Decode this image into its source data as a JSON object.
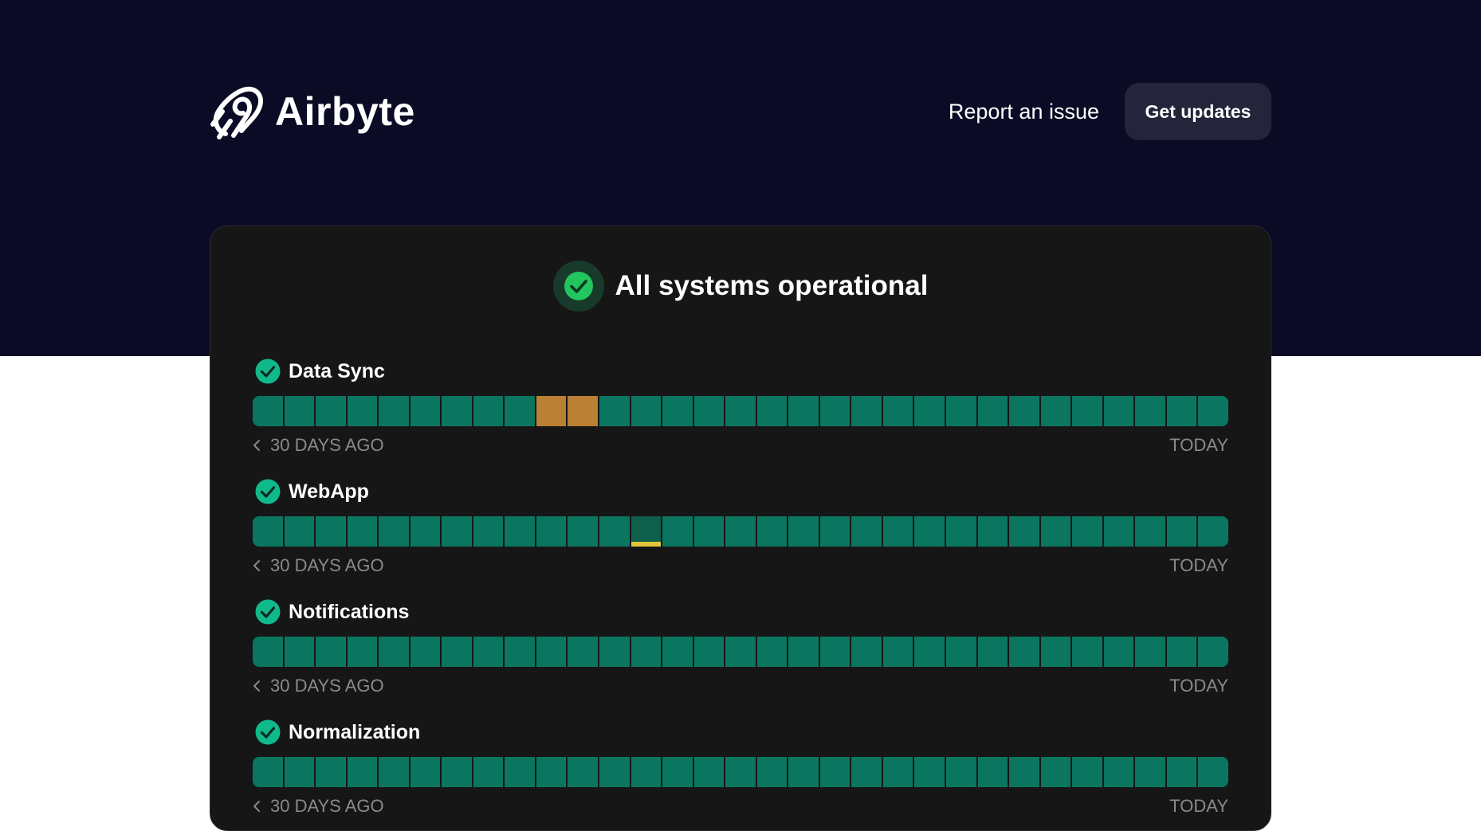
{
  "brand": {
    "name": "Airbyte",
    "logo_icon": "airbyte-logo-icon"
  },
  "nav": {
    "report_label": "Report an issue",
    "updates_label": "Get updates"
  },
  "colors": {
    "hero_bg": "#0b0b26",
    "card_bg": "#161616",
    "operational": "#0a7660",
    "operational_check": "#10b98c",
    "partial_outage": "#d9822b",
    "degraded": "#e2c53a"
  },
  "overall_status": {
    "icon": "check-circle-icon",
    "text": "All systems operational"
  },
  "days_shown": 31,
  "components": [
    {
      "name": "Data Sync",
      "icon": "check-circle-icon",
      "range_start": "30 DAYS AGO",
      "range_end": "TODAY",
      "incidents": [
        {
          "day_index": 9,
          "severity": "partial_outage",
          "level": 1.0
        },
        {
          "day_index": 10,
          "severity": "partial_outage",
          "level": 1.0
        }
      ]
    },
    {
      "name": "WebApp",
      "icon": "check-circle-icon",
      "range_start": "30 DAYS AGO",
      "range_end": "TODAY",
      "incidents": [
        {
          "day_index": 12,
          "severity": "degraded",
          "level": 0.15
        }
      ]
    },
    {
      "name": "Notifications",
      "icon": "check-circle-icon",
      "range_start": "30 DAYS AGO",
      "range_end": "TODAY",
      "incidents": []
    },
    {
      "name": "Normalization",
      "icon": "check-circle-icon",
      "range_start": "30 DAYS AGO",
      "range_end": "TODAY",
      "incidents": []
    }
  ]
}
